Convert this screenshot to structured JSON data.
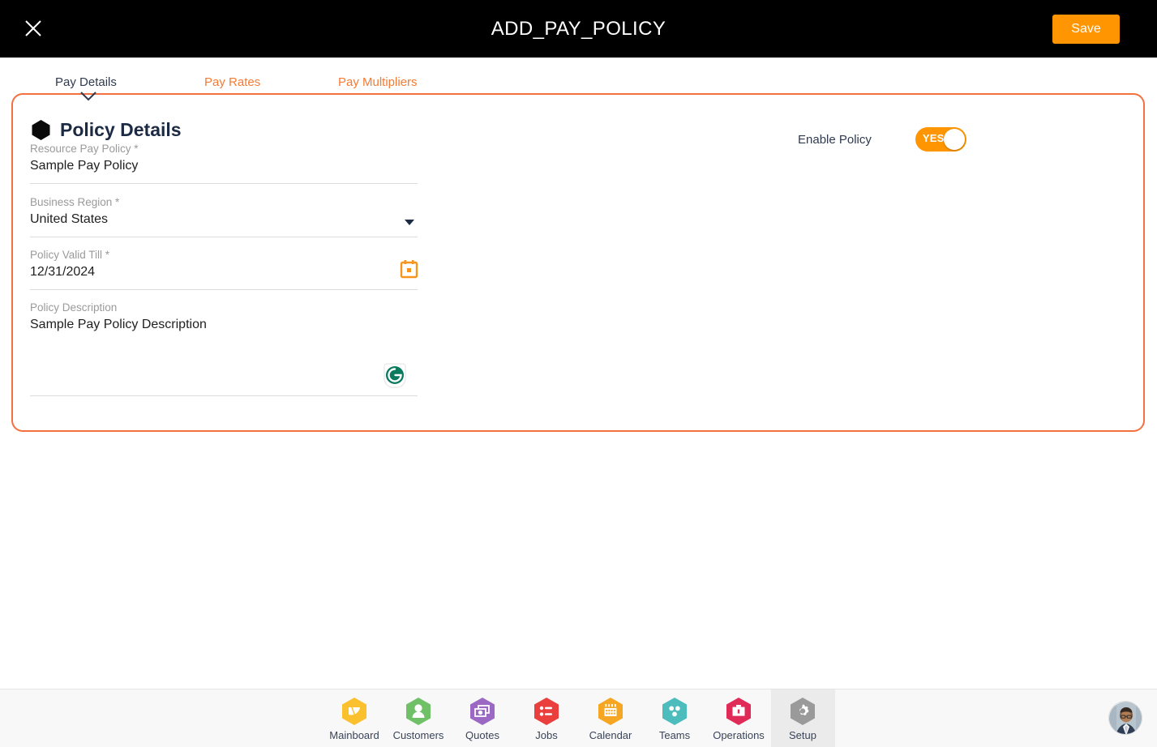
{
  "topbar": {
    "title": "ADD_PAY_POLICY",
    "close_icon": "close-icon",
    "save_label": "Save"
  },
  "tabs": [
    {
      "label": "Pay Details",
      "active": true
    },
    {
      "label": "Pay Rates",
      "active": false
    },
    {
      "label": "Pay Multipliers",
      "active": false
    }
  ],
  "card": {
    "section_title": "Policy Details",
    "section_icon": "hexagon-bullet-icon",
    "fields": {
      "resource_pay_policy": {
        "label": "Resource Pay Policy *",
        "value": "Sample Pay Policy"
      },
      "business_region": {
        "label": "Business Region *",
        "value": "United States",
        "caret_icon": "chevron-down-icon"
      },
      "policy_valid_till": {
        "label": "Policy Valid Till *",
        "value": "12/31/2024",
        "calendar_icon": "calendar-icon"
      },
      "policy_description": {
        "label": "Policy Description",
        "value": "Sample Pay Policy Description",
        "assistant_icon": "grammarly-icon"
      }
    },
    "enable_policy": {
      "label": "Enable Policy",
      "toggle_value": "YES",
      "toggle_on": true
    }
  },
  "bottom_nav": {
    "items": [
      {
        "label": "Mainboard",
        "icon": "mainboard-icon",
        "color": "#fbc02d",
        "active": false
      },
      {
        "label": "Customers",
        "icon": "customers-icon",
        "color": "#6fc067",
        "active": false
      },
      {
        "label": "Quotes",
        "icon": "quotes-icon",
        "color": "#9b69c4",
        "active": false
      },
      {
        "label": "Jobs",
        "icon": "jobs-icon",
        "color": "#ea3f3c",
        "active": false
      },
      {
        "label": "Calendar",
        "icon": "calendar-icon",
        "color": "#f5a623",
        "active": false
      },
      {
        "label": "Teams",
        "icon": "teams-icon",
        "color": "#4cbcbd",
        "active": false
      },
      {
        "label": "Operations",
        "icon": "operations-icon",
        "color": "#e02a58",
        "active": false
      },
      {
        "label": "Setup",
        "icon": "setup-icon",
        "color": "#9a9a9a",
        "active": true
      }
    ],
    "avatar": "user-avatar"
  },
  "colors": {
    "accent_orange": "#ff9500",
    "card_border": "#f4713f",
    "tab_inactive": "#f47b33",
    "tab_active": "#2f3a4f",
    "topbar_bg": "#000000"
  }
}
